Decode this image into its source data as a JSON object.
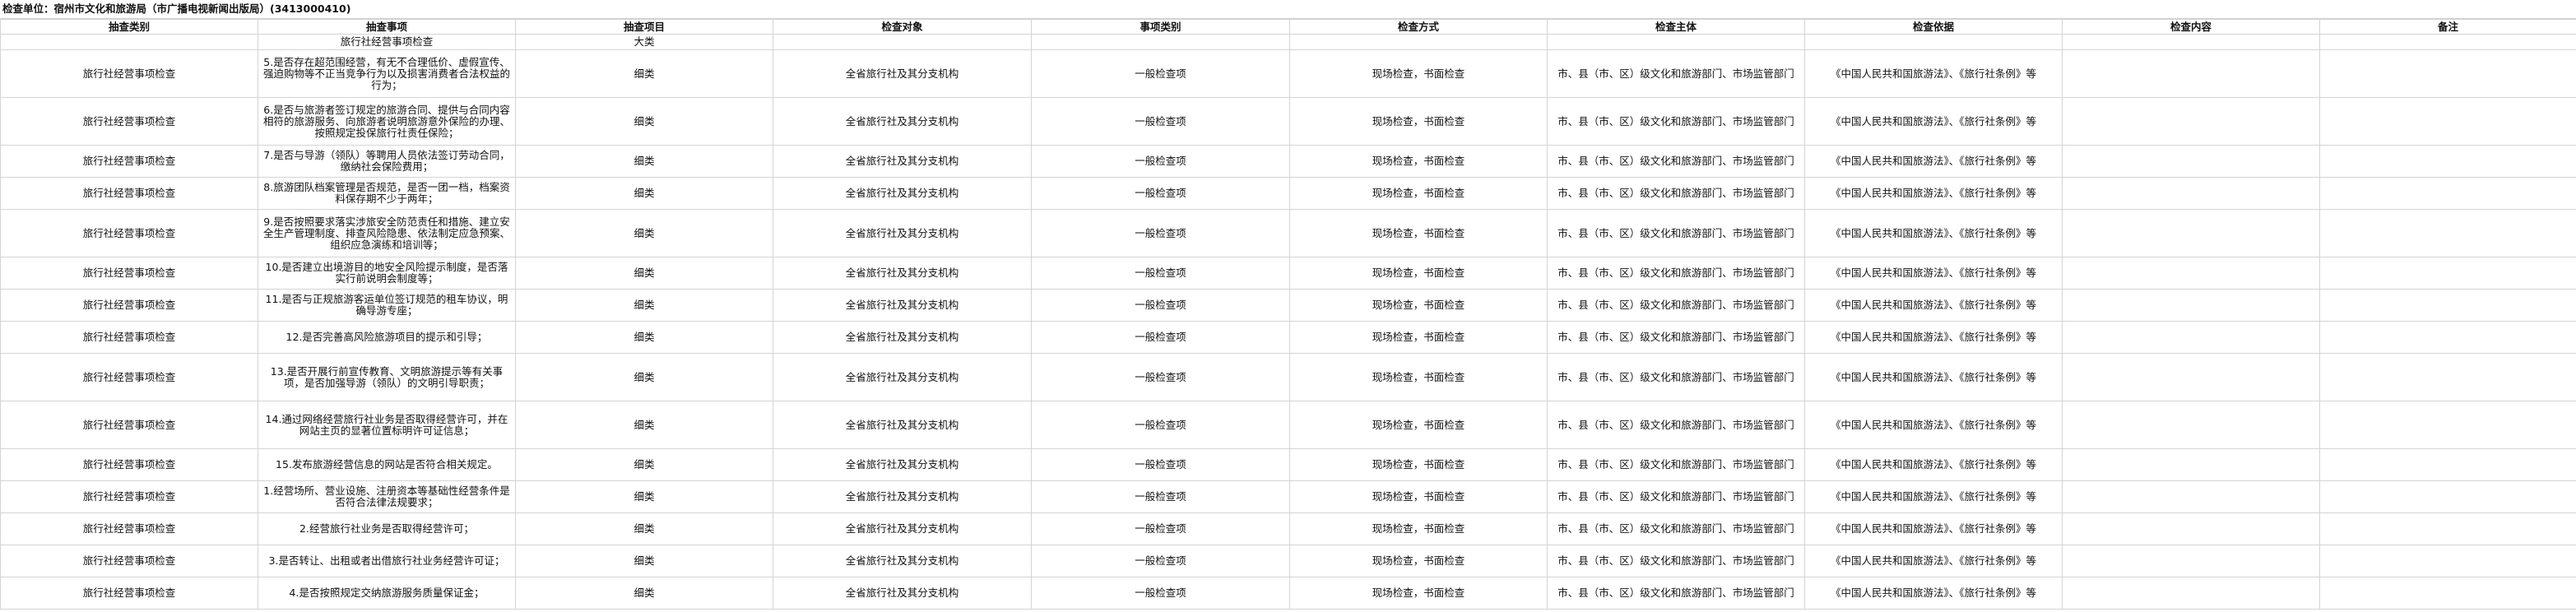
{
  "unit_title": "检查单位：宿州市文化和旅游局（市广播电视新闻出版局）(3413000410)",
  "headers": [
    "抽查类别",
    "抽查事项",
    "抽查项目",
    "检查对象",
    "事项类别",
    "检查方式",
    "检查主体",
    "检查依据",
    "检查内容",
    "备注"
  ],
  "subheader": {
    "item": "旅行社经营事项检查",
    "project": "大类"
  },
  "rows": [
    {
      "category": "旅行社经营事项检查",
      "item": "5.是否存在超范围经营，有无不合理低价、虚假宣传、强迫购物等不正当竞争行为以及损害消费者合法权益的行为；",
      "project": "细类",
      "object": "全省旅行社及其分支机构",
      "type": "一般检查项",
      "method": "现场检查，书面检查",
      "subject": "市、县（市、区）级文化和旅游部门、市场监管部门",
      "basis": "《中国人民共和国旅游法》、《旅行社条例》等",
      "content": "",
      "note": ""
    },
    {
      "category": "旅行社经营事项检查",
      "item": "6.是否与旅游者签订规定的旅游合同、提供与合同内容相符的旅游服务、向旅游者说明旅游意外保险的办理、按照规定投保旅行社责任保险；",
      "project": "细类",
      "object": "全省旅行社及其分支机构",
      "type": "一般检查项",
      "method": "现场检查，书面检查",
      "subject": "市、县（市、区）级文化和旅游部门、市场监管部门",
      "basis": "《中国人民共和国旅游法》、《旅行社条例》等",
      "content": "",
      "note": ""
    },
    {
      "category": "旅行社经营事项检查",
      "item": "7.是否与导游（领队）等聘用人员依法签订劳动合同，缴纳社会保险费用；",
      "project": "细类",
      "object": "全省旅行社及其分支机构",
      "type": "一般检查项",
      "method": "现场检查，书面检查",
      "subject": "市、县（市、区）级文化和旅游部门、市场监管部门",
      "basis": "《中国人民共和国旅游法》、《旅行社条例》等",
      "content": "",
      "note": ""
    },
    {
      "category": "旅行社经营事项检查",
      "item": "8.旅游团队档案管理是否规范，是否一团一档，档案资料保存期不少于两年；",
      "project": "细类",
      "object": "全省旅行社及其分支机构",
      "type": "一般检查项",
      "method": "现场检查，书面检查",
      "subject": "市、县（市、区）级文化和旅游部门、市场监管部门",
      "basis": "《中国人民共和国旅游法》、《旅行社条例》等",
      "content": "",
      "note": ""
    },
    {
      "category": "旅行社经营事项检查",
      "item": "9.是否按照要求落实涉旅安全防范责任和措施、建立安全生产管理制度、排查风险隐患、依法制定应急预案、组织应急演练和培训等；",
      "project": "细类",
      "object": "全省旅行社及其分支机构",
      "type": "一般检查项",
      "method": "现场检查，书面检查",
      "subject": "市、县（市、区）级文化和旅游部门、市场监管部门",
      "basis": "《中国人民共和国旅游法》、《旅行社条例》等",
      "content": "",
      "note": ""
    },
    {
      "category": "旅行社经营事项检查",
      "item": "10.是否建立出境游目的地安全风险提示制度，是否落实行前说明会制度等；",
      "project": "细类",
      "object": "全省旅行社及其分支机构",
      "type": "一般检查项",
      "method": "现场检查，书面检查",
      "subject": "市、县（市、区）级文化和旅游部门、市场监管部门",
      "basis": "《中国人民共和国旅游法》、《旅行社条例》等",
      "content": "",
      "note": ""
    },
    {
      "category": "旅行社经营事项检查",
      "item": "11.是否与正规旅游客运单位签订规范的租车协议，明确导游专座；",
      "project": "细类",
      "object": "全省旅行社及其分支机构",
      "type": "一般检查项",
      "method": "现场检查，书面检查",
      "subject": "市、县（市、区）级文化和旅游部门、市场监管部门",
      "basis": "《中国人民共和国旅游法》、《旅行社条例》等",
      "content": "",
      "note": ""
    },
    {
      "category": "旅行社经营事项检查",
      "item": "12.是否完善高风险旅游项目的提示和引导；",
      "project": "细类",
      "object": "全省旅行社及其分支机构",
      "type": "一般检查项",
      "method": "现场检查，书面检查",
      "subject": "市、县（市、区）级文化和旅游部门、市场监管部门",
      "basis": "《中国人民共和国旅游法》、《旅行社条例》等",
      "content": "",
      "note": ""
    },
    {
      "category": "旅行社经营事项检查",
      "item": "13.是否开展行前宣传教育、文明旅游提示等有关事项，是否加强导游（领队）的文明引导职责；",
      "project": "细类",
      "object": "全省旅行社及其分支机构",
      "type": "一般检查项",
      "method": "现场检查，书面检查",
      "subject": "市、县（市、区）级文化和旅游部门、市场监管部门",
      "basis": "《中国人民共和国旅游法》、《旅行社条例》等",
      "content": "",
      "note": ""
    },
    {
      "category": "旅行社经营事项检查",
      "item": "14.通过网络经营旅行社业务是否取得经营许可，并在网站主页的显著位置标明许可证信息；",
      "project": "细类",
      "object": "全省旅行社及其分支机构",
      "type": "一般检查项",
      "method": "现场检查，书面检查",
      "subject": "市、县（市、区）级文化和旅游部门、市场监管部门",
      "basis": "《中国人民共和国旅游法》、《旅行社条例》等",
      "content": "",
      "note": ""
    },
    {
      "category": "旅行社经营事项检查",
      "item": "15.发布旅游经营信息的网站是否符合相关规定。",
      "project": "细类",
      "object": "全省旅行社及其分支机构",
      "type": "一般检查项",
      "method": "现场检查，书面检查",
      "subject": "市、县（市、区）级文化和旅游部门、市场监管部门",
      "basis": "《中国人民共和国旅游法》、《旅行社条例》等",
      "content": "",
      "note": ""
    },
    {
      "category": "旅行社经营事项检查",
      "item": "1.经营场所、营业设施、注册资本等基础性经营条件是否符合法律法规要求；",
      "project": "细类",
      "object": "全省旅行社及其分支机构",
      "type": "一般检查项",
      "method": "现场检查，书面检查",
      "subject": "市、县（市、区）级文化和旅游部门、市场监管部门",
      "basis": "《中国人民共和国旅游法》、《旅行社条例》等",
      "content": "",
      "note": ""
    },
    {
      "category": "旅行社经营事项检查",
      "item": "2.经营旅行社业务是否取得经营许可；",
      "project": "细类",
      "object": "全省旅行社及其分支机构",
      "type": "一般检查项",
      "method": "现场检查，书面检查",
      "subject": "市、县（市、区）级文化和旅游部门、市场监管部门",
      "basis": "《中国人民共和国旅游法》、《旅行社条例》等",
      "content": "",
      "note": ""
    },
    {
      "category": "旅行社经营事项检查",
      "item": "3.是否转让、出租或者出借旅行社业务经营许可证；",
      "project": "细类",
      "object": "全省旅行社及其分支机构",
      "type": "一般检查项",
      "method": "现场检查，书面检查",
      "subject": "市、县（市、区）级文化和旅游部门、市场监管部门",
      "basis": "《中国人民共和国旅游法》、《旅行社条例》等",
      "content": "",
      "note": ""
    },
    {
      "category": "旅行社经营事项检查",
      "item": "4.是否按照规定交纳旅游服务质量保证金；",
      "project": "细类",
      "object": "全省旅行社及其分支机构",
      "type": "一般检查项",
      "method": "现场检查，书面检查",
      "subject": "市、县（市、区）级文化和旅游部门、市场监管部门",
      "basis": "《中国人民共和国旅游法》、《旅行社条例》等",
      "content": "",
      "note": ""
    }
  ]
}
